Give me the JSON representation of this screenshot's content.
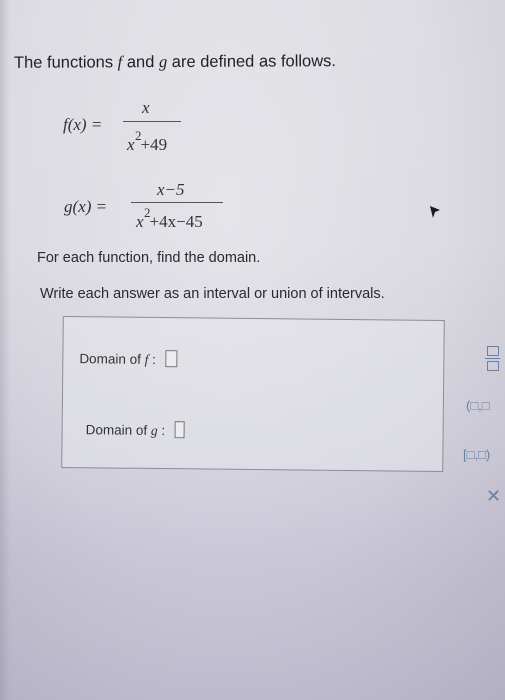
{
  "heading": {
    "part1": "The functions ",
    "f": "f",
    "part2": " and ",
    "g": "g",
    "part3": " are defined as follows."
  },
  "f_def": {
    "lhs": "f(x) =",
    "numerator": "x",
    "den_base": "x",
    "den_exp": "2",
    "den_rest": "+49"
  },
  "g_def": {
    "lhs": "g(x) =",
    "numerator": "x−5",
    "den_base": "x",
    "den_exp": "2",
    "den_rest": "+4x−45"
  },
  "instructions": {
    "line1": "For each function, find the domain.",
    "line2": "Write each answer as an interval or union of intervals."
  },
  "answers": {
    "f_label": "Domain of",
    "f_var": "f",
    "f_colon": ":",
    "g_label": "Domain of",
    "g_var": "g",
    "g_colon": ":"
  },
  "toolbar": {
    "open_interval": "(□,□",
    "closed_interval": "[□,□)",
    "fraction_icon": "fraction-icon",
    "close_icon": "close-icon"
  },
  "colors": {
    "toolbar_blue": "#6a7fa8",
    "text": "#2a2a2e"
  }
}
